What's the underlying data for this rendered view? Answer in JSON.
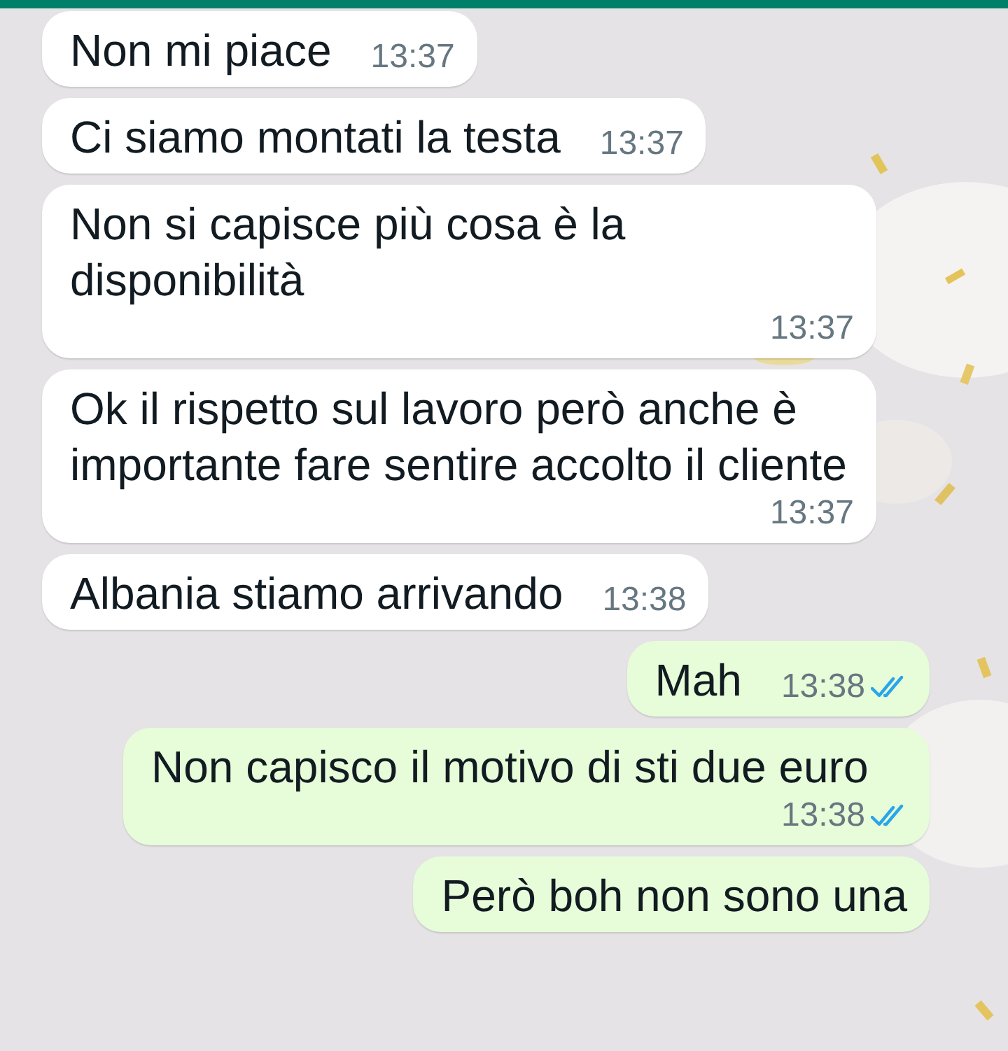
{
  "messages": [
    {
      "kind": "incoming",
      "text": "Non mi piace",
      "time": "13:37"
    },
    {
      "kind": "incoming",
      "text": "Ci siamo montati la testa",
      "time": "13:37"
    },
    {
      "kind": "incoming",
      "text": "Non si capisce più cosa è la disponibilità",
      "time": "13:37"
    },
    {
      "kind": "incoming",
      "text": "Ok il rispetto sul lavoro però anche è importante fare sentire accolto il cliente",
      "time": "13:37"
    },
    {
      "kind": "incoming",
      "text": "Albania stiamo arrivando",
      "time": "13:38"
    },
    {
      "kind": "outgoing",
      "text": "Mah",
      "time": "13:38",
      "read": true
    },
    {
      "kind": "outgoing",
      "text": "Non capisco il motivo di sti due euro",
      "time": "13:38",
      "read": true
    },
    {
      "kind": "outgoing",
      "text": "Però boh non sono una"
    }
  ]
}
